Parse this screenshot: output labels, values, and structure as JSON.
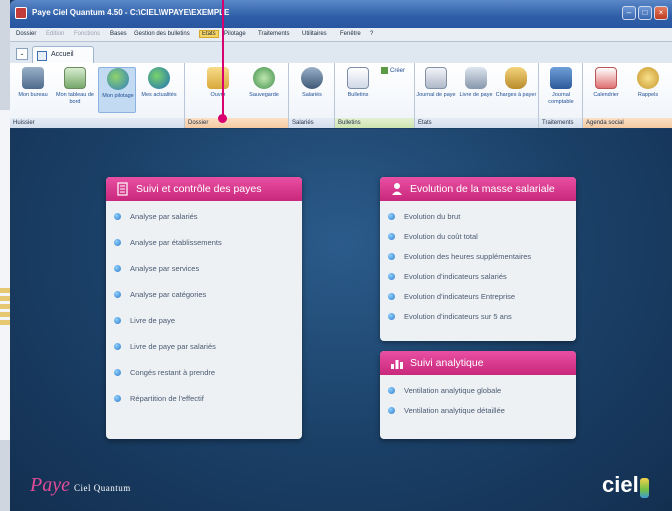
{
  "window": {
    "title": "Paye Ciel Quantum 4.50 - C:\\CIEL\\WPAYE\\EXEMPLE"
  },
  "menu": [
    {
      "label": "Dossier",
      "state": "normal"
    },
    {
      "label": "Edition",
      "state": "disabled"
    },
    {
      "label": "Fonctions",
      "state": "disabled"
    },
    {
      "label": "Bases",
      "state": "normal"
    },
    {
      "label": "Gestion des bulletins",
      "state": "normal"
    },
    {
      "label": "Etats",
      "state": "active"
    },
    {
      "label": "Pilotage",
      "state": "normal"
    },
    {
      "label": "Traitements",
      "state": "normal"
    },
    {
      "label": "Utilitaires",
      "state": "normal"
    },
    {
      "label": "Fenêtre",
      "state": "normal"
    },
    {
      "label": "?",
      "state": "normal"
    }
  ],
  "ribbon": {
    "tab": "Accueil",
    "groups": {
      "huissier": "Huissier",
      "dossier": "Dossier",
      "salaries": "Salariés",
      "bulletins": "Bulletins",
      "etats": "Etats",
      "traitements": "Traitements",
      "agenda": "Agenda social"
    },
    "buttons": {
      "mon_bureau": "Mon bureau",
      "mon_tableau": "Mon tableau de bord",
      "mon_pilotage": "Mon pilotage",
      "mes_actualites": "Mes actualités",
      "ouvrir": "Ouvrir",
      "sauvegarde": "Sauvegarde",
      "salaries": "Salariés",
      "bulletins": "Bulletins",
      "creer": "Créer",
      "journal_paye": "Journal de paye",
      "livre_paye": "Livre de paye",
      "charges_payer": "Charges à payer",
      "journal_comptable": "Journal comptable",
      "calendrier": "Calendrier",
      "rappels": "Rappels"
    }
  },
  "panels": {
    "payes": {
      "title": "Suivi et contrôle des payes",
      "items": [
        "Analyse par salariés",
        "Analyse par établissements",
        "Analyse par services",
        "Analyse par catégories",
        "Livre de paye",
        "Livre de paye par salariés",
        "Congés restant à prendre",
        "Répartition de l'effectif"
      ]
    },
    "masse": {
      "title": "Evolution de la masse salariale",
      "items": [
        "Evolution du brut",
        "Evolution du coût total",
        "Evolution des heures supplémentaires",
        "Evolution d'indicateurs salariés",
        "Evolution d'indicateurs Entreprise",
        "Evolution d'indicateurs sur 5 ans"
      ]
    },
    "analytique": {
      "title": "Suivi analytique",
      "items": [
        "Ventilation analytique globale",
        "Ventilation analytique détaillée"
      ]
    }
  },
  "branding": {
    "product": "Paye",
    "edition": "Ciel Quantum",
    "logo": "ciel"
  },
  "colors": {
    "accent_pink": "#d8006e",
    "panel_header": "#e04b97",
    "background_blue": "#1a3f66"
  }
}
